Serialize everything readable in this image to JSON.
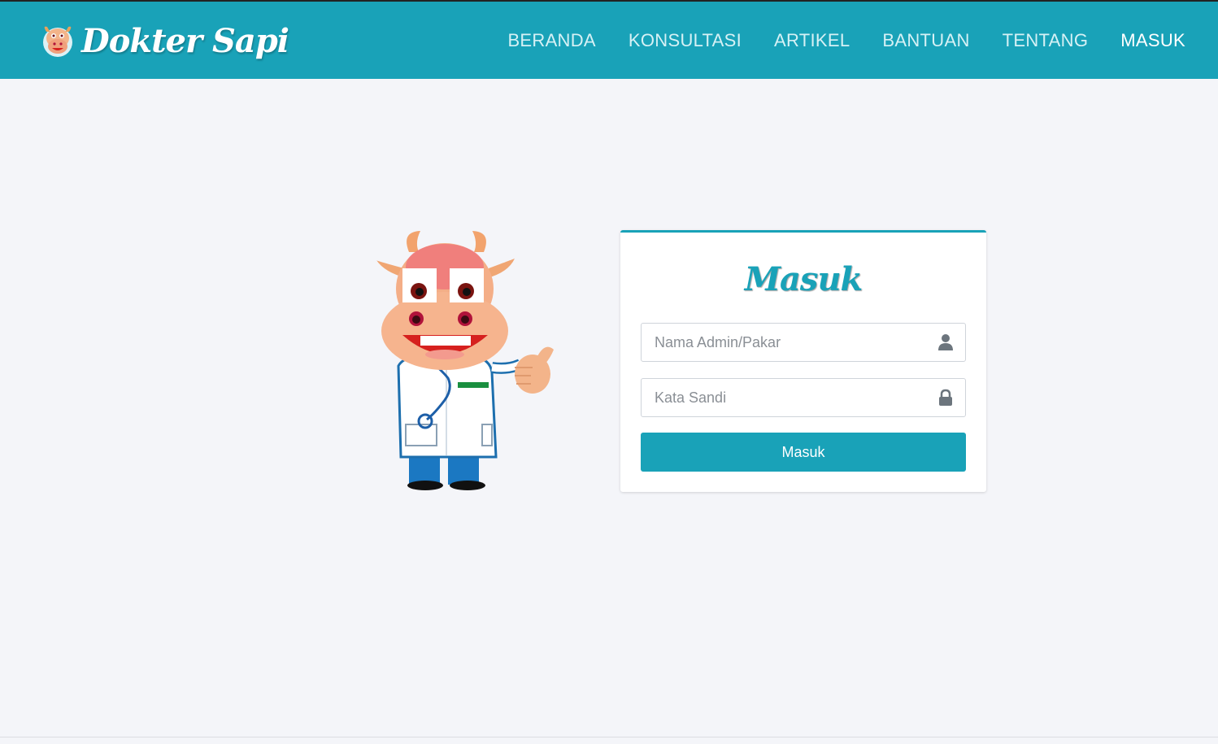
{
  "brand": {
    "name": "Dokter Sapi",
    "logo_icon": "cow-face-icon"
  },
  "nav": {
    "items": [
      {
        "label": "BERANDA"
      },
      {
        "label": "KONSULTASI"
      },
      {
        "label": "ARTIKEL"
      },
      {
        "label": "BANTUAN"
      },
      {
        "label": "TENTANG"
      },
      {
        "label": "MASUK",
        "active": true
      }
    ]
  },
  "mascot": {
    "icon": "cow-doctor-mascot-illustration"
  },
  "login": {
    "title": "Masuk",
    "username": {
      "value": "",
      "placeholder": "Nama Admin/Pakar",
      "icon": "user-icon"
    },
    "password": {
      "value": "",
      "placeholder": "Kata Sandi",
      "icon": "lock-icon"
    },
    "submit_label": "Masuk"
  },
  "colors": {
    "accent": "#19a2b8",
    "background": "#f4f5f9",
    "card": "#ffffff"
  }
}
